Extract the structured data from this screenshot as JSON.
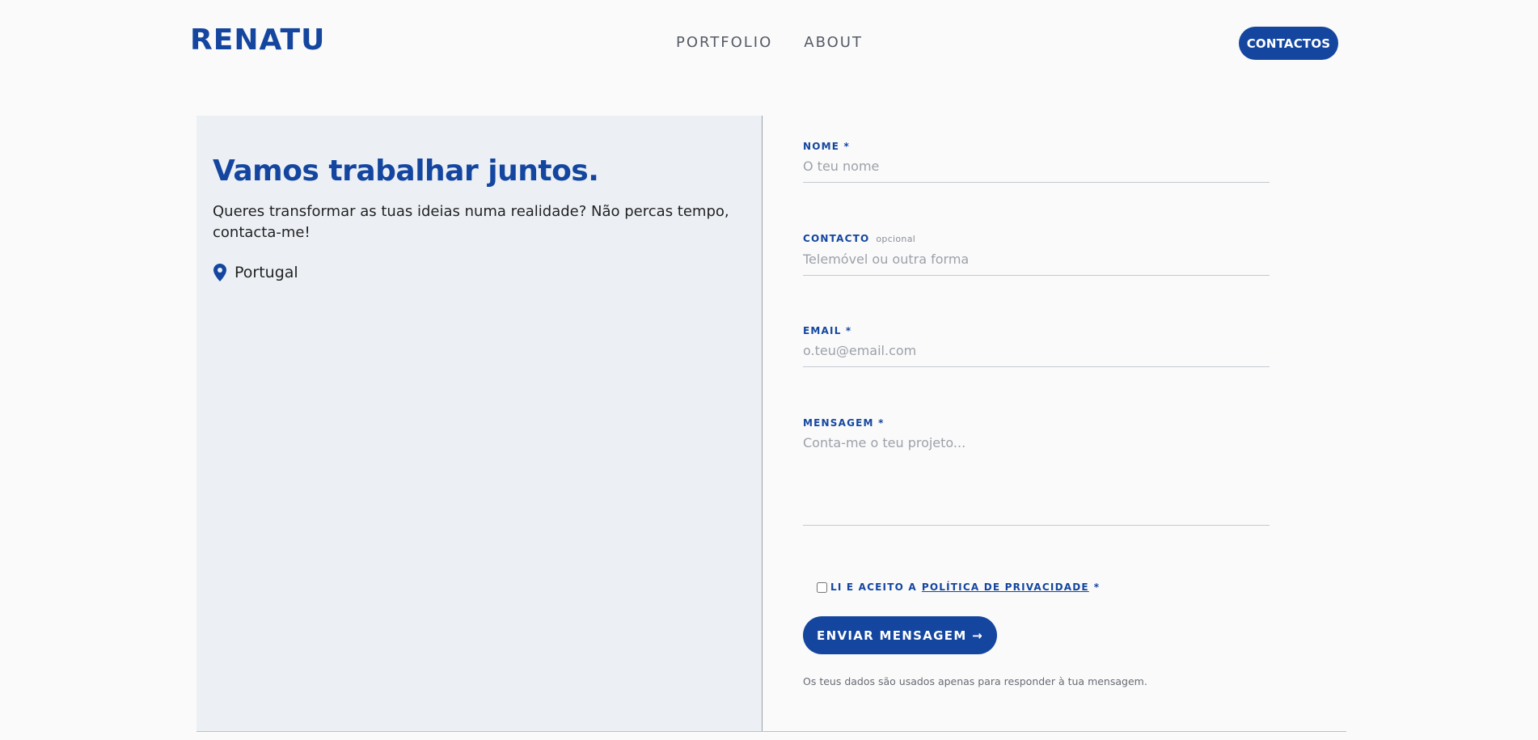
{
  "header": {
    "logo": "RENATU",
    "nav": [
      "PORTFOLIO",
      "ABOUT"
    ],
    "cta": "CONTACTOS"
  },
  "intro": {
    "title": "Vamos trabalhar juntos.",
    "text": "Queres transformar as tuas ideias numa realidade? Não percas tempo, contacta-me!",
    "location": "Portugal",
    "location_icon": "map-pin-icon"
  },
  "form": {
    "name": {
      "label": "NOME *",
      "placeholder": "O teu nome",
      "value": ""
    },
    "contact": {
      "label": "CONTACTO",
      "optional": "opcional",
      "placeholder": "Telemóvel ou outra forma",
      "value": ""
    },
    "email": {
      "label": "EMAIL *",
      "placeholder": "o.teu@email.com",
      "value": ""
    },
    "message": {
      "label": "MENSAGEM *",
      "placeholder": "Conta-me o teu projeto...",
      "value": ""
    },
    "consent": {
      "prefix": "LI E ACEITO A",
      "link": "POLÍTICA DE PRIVACIDADE",
      "suffix": "*",
      "checked": false
    },
    "submit": "ENVIAR MENSAGEM →",
    "note": "Os teus dados são usados apenas para responder à tua mensagem."
  },
  "colors": {
    "accent": "#1446a0",
    "panel": "#ecf0f5",
    "background": "#fafafa"
  }
}
